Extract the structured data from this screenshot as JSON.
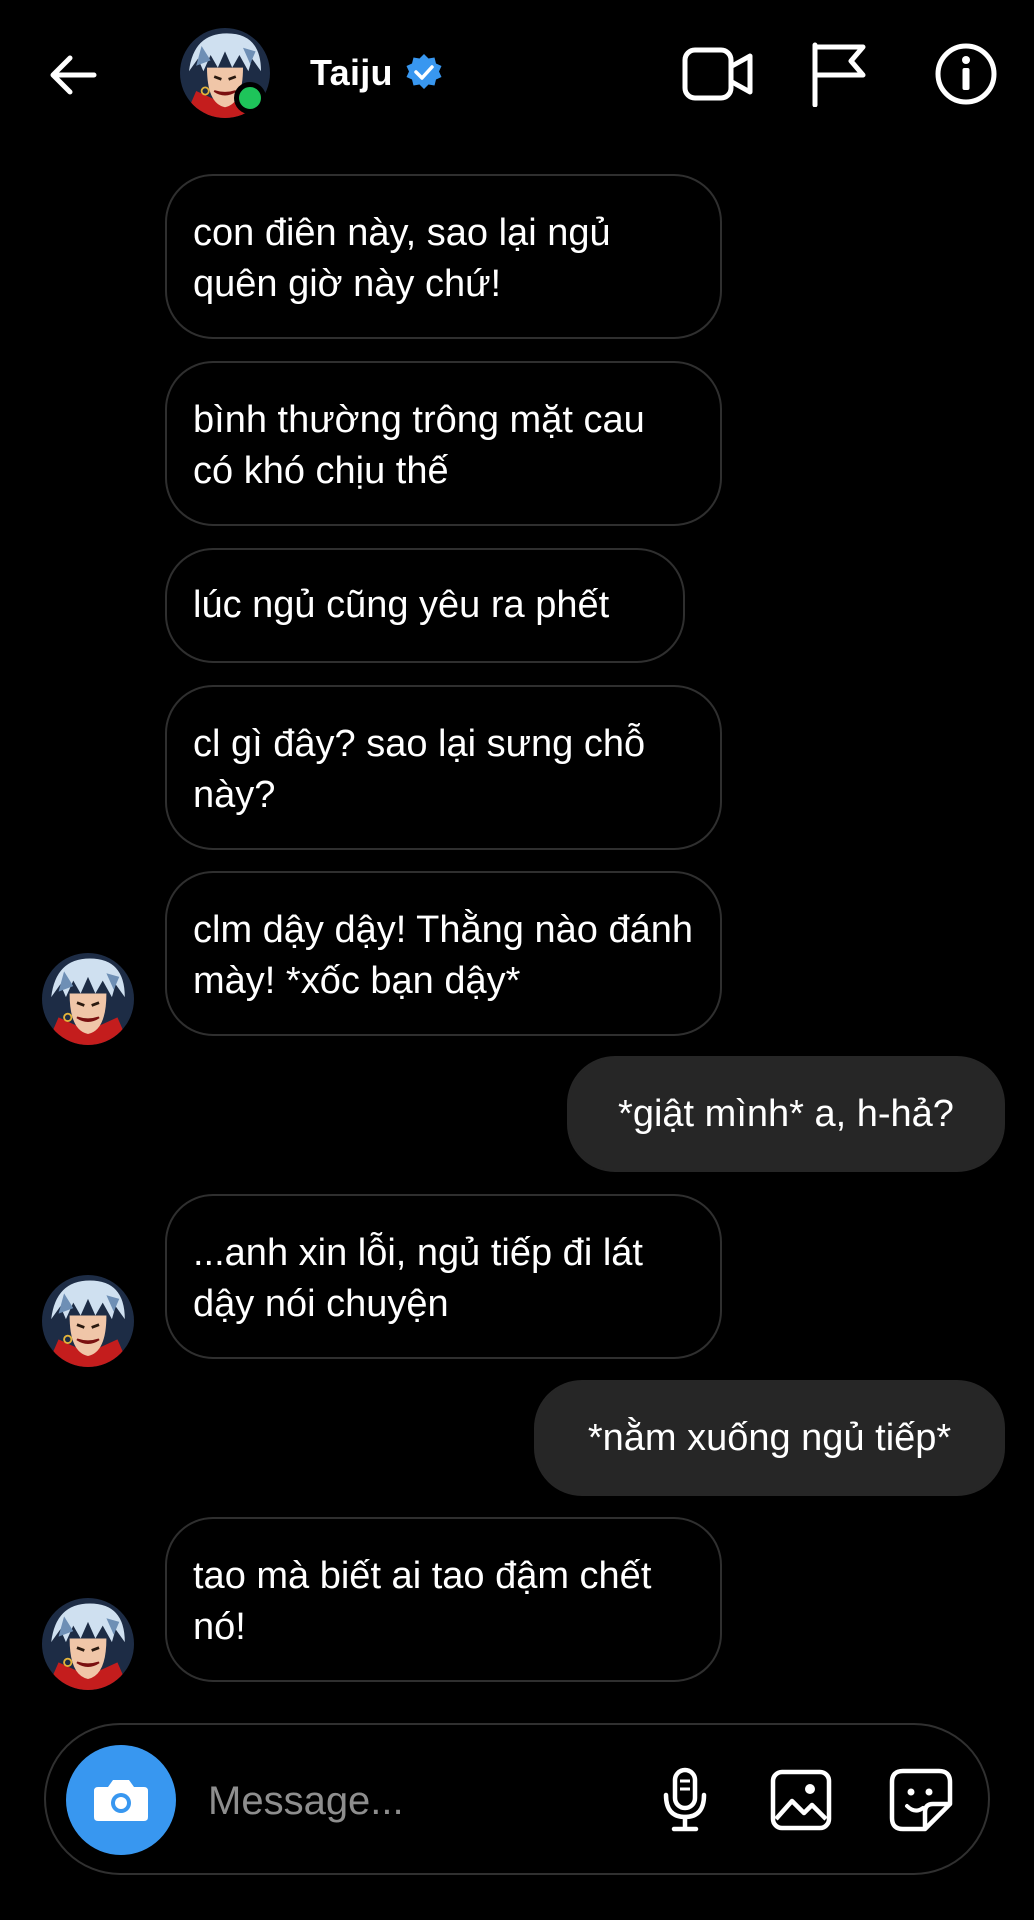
{
  "header": {
    "contact_name": "Taiju",
    "verified": true,
    "online": true,
    "icons": [
      "back-arrow-icon",
      "video-call-icon",
      "flag-icon",
      "info-icon"
    ]
  },
  "messages": [
    {
      "sender": "them",
      "text": "con điên này, sao lại ngủ quên giờ này chứ!"
    },
    {
      "sender": "them",
      "text": "bình thường trông mặt cau có khó chịu thế"
    },
    {
      "sender": "them",
      "text": "lúc ngủ cũng yêu ra phết"
    },
    {
      "sender": "them",
      "text": "cl gì đây? sao lại sưng chỗ này?"
    },
    {
      "sender": "them",
      "text": "clm dậy dậy! Thằng nào đánh mày! *xốc bạn dậy*"
    },
    {
      "sender": "me",
      "text": "*giật mình* a, h-hả?"
    },
    {
      "sender": "them",
      "text": "...anh xin lỗi, ngủ tiếp đi lát dậy nói chuyện"
    },
    {
      "sender": "me",
      "text": "*nằm xuống ngủ tiếp*"
    },
    {
      "sender": "them",
      "text": "tao mà biết ai tao đậm chết nó!"
    }
  ],
  "composer": {
    "placeholder": "Message...",
    "icons": [
      "camera-icon",
      "microphone-icon",
      "gallery-icon",
      "sticker-icon"
    ]
  },
  "colors": {
    "background": "#000000",
    "received_bubble_border": "#2f2f2f",
    "sent_bubble": "#262626",
    "online_dot": "#1ec45a",
    "verified_badge": "#3897f0",
    "camera_button": "#3897f0",
    "placeholder": "#8e8e8e"
  }
}
